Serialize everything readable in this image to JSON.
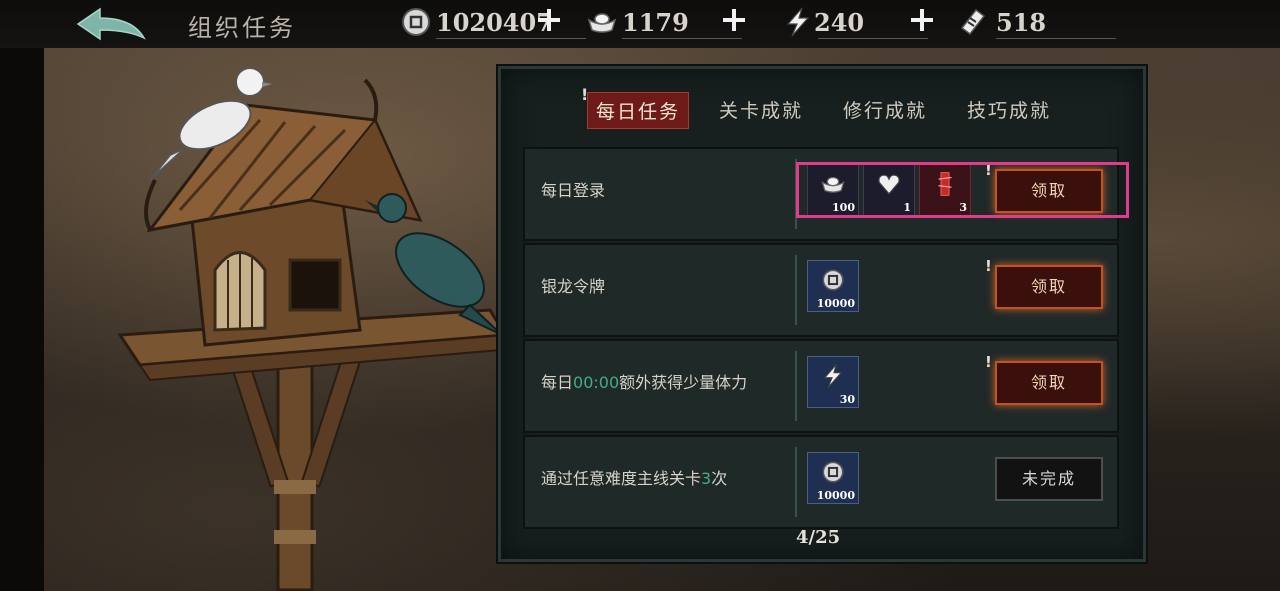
{
  "header": {
    "title": "组织任务",
    "resources": [
      {
        "icon": "copper-coin-icon",
        "value": "1020407"
      },
      {
        "icon": "silver-ingot-icon",
        "value": "1179"
      },
      {
        "icon": "lightning-stamina-icon",
        "value": "240"
      },
      {
        "icon": "ticket-icon",
        "value": "518"
      }
    ]
  },
  "tabs": [
    {
      "label": "每日任务",
      "active": true
    },
    {
      "label": "关卡成就",
      "active": false
    },
    {
      "label": "修行成就",
      "active": false
    },
    {
      "label": "技巧成就",
      "active": false
    }
  ],
  "tasks": [
    {
      "name": "每日登录",
      "rewards": [
        {
          "icon": "silver-ingot-icon",
          "count": "100"
        },
        {
          "icon": "heart-charm-icon",
          "count": "1"
        },
        {
          "icon": "red-scroll-icon",
          "count": "3"
        }
      ],
      "button": "领取"
    },
    {
      "name": "银龙令牌",
      "rewards": [
        {
          "icon": "copper-coin-icon",
          "count": "10000"
        }
      ],
      "button": "领取"
    },
    {
      "name_parts": [
        "每日",
        "00:00",
        "额外获得少量体力"
      ],
      "rewards": [
        {
          "icon": "lightning-stamina-icon",
          "count": "30"
        }
      ],
      "button": "领取"
    },
    {
      "name_parts": [
        "通过任意难度主线关卡",
        "3",
        "次"
      ],
      "rewards": [
        {
          "icon": "copper-coin-icon",
          "count": "10000"
        }
      ],
      "button": "未完成"
    }
  ],
  "pagination": "4/25",
  "colors": {
    "accent_highlight": "#e03b8c",
    "tab_active": "#6e1a18",
    "claim_glow": "#d0602a",
    "text_highlight": "#3fae8a"
  }
}
